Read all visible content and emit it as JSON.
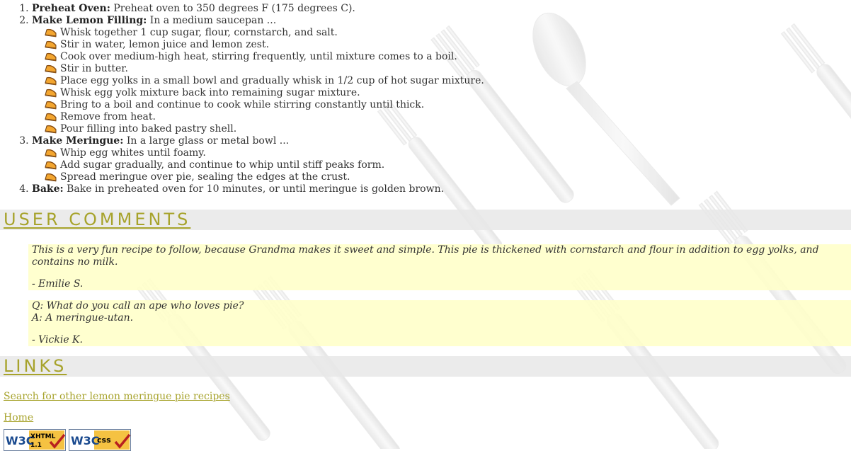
{
  "steps": [
    {
      "title": "Preheat Oven:",
      "text": " Preheat oven to 350 degrees F (175 degrees C).",
      "substeps": []
    },
    {
      "title": "Make Lemon Filling:",
      "text": " In a medium saucepan ...",
      "substeps": [
        "Whisk together 1 cup sugar, flour, cornstarch, and salt.",
        "Stir in water, lemon juice and lemon zest.",
        "Cook over medium-high heat, stirring frequently, until mixture comes to a boil.",
        "Stir in butter.",
        "Place egg yolks in a small bowl and gradually whisk in 1/2 cup of hot sugar mixture.",
        "Whisk egg yolk mixture back into remaining sugar mixture.",
        "Bring to a boil and continue to cook while stirring constantly until thick.",
        "Remove from heat.",
        "Pour filling into baked pastry shell."
      ]
    },
    {
      "title": "Make Meringue:",
      "text": " In a large glass or metal bowl ...",
      "substeps": [
        "Whip egg whites until foamy.",
        "Add sugar gradually, and continue to whip until stiff peaks form.",
        "Spread meringue over pie, sealing the edges at the crust."
      ]
    },
    {
      "title": "Bake:",
      "text": " Bake in preheated oven for 10 minutes, or until meringue is golden brown.",
      "substeps": []
    }
  ],
  "comments_heading": "USER COMMENTS",
  "comments": [
    {
      "lines": [
        "This is a very fun recipe to follow, because Grandma makes it sweet and simple. This pie is thickened with cornstarch and flour in addition to egg yolks, and contains no milk."
      ],
      "author": "- Emilie S."
    },
    {
      "lines": [
        "Q: What do you call an ape who loves pie?",
        "A: A meringue-utan."
      ],
      "author": "- Vickie K."
    }
  ],
  "links_heading": "LINKS",
  "links": {
    "search": "Search for other lemon meringue pie recipes",
    "home": "Home"
  },
  "badges": {
    "xhtml": {
      "w3c": "W3C",
      "label": "XHTML",
      "version": "1.1"
    },
    "css": {
      "w3c": "W3C",
      "label": "css"
    }
  },
  "colors": {
    "accent": "#a7a32c",
    "comment_bg": "#ffffc8",
    "heading_bg": "#e8e8e8"
  }
}
